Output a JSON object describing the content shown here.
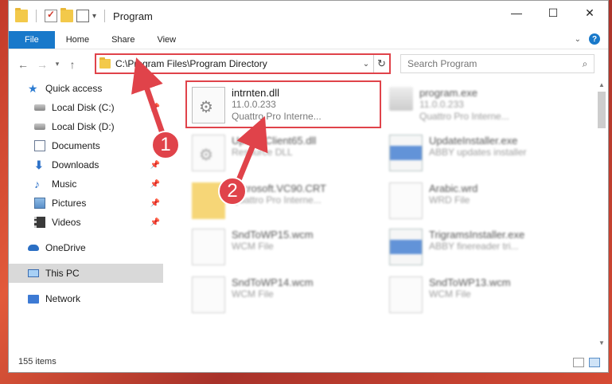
{
  "window": {
    "title": "Program"
  },
  "ribbon": {
    "tabs": [
      {
        "label": "File"
      },
      {
        "label": "Home"
      },
      {
        "label": "Share"
      },
      {
        "label": "View"
      }
    ],
    "help_label": "?"
  },
  "address": {
    "path": "C:\\Program Files\\Program Directory"
  },
  "search": {
    "placeholder": "Search Program"
  },
  "sidebar": {
    "items": [
      {
        "label": "Quick access"
      },
      {
        "label": "Local Disk (C:)"
      },
      {
        "label": "Local Disk (D:)"
      },
      {
        "label": "Documents"
      },
      {
        "label": "Downloads"
      },
      {
        "label": "Music"
      },
      {
        "label": "Pictures"
      },
      {
        "label": "Videos"
      },
      {
        "label": "OneDrive"
      },
      {
        "label": "This PC"
      },
      {
        "label": "Network"
      }
    ]
  },
  "files": [
    {
      "name": "intrnten.dll",
      "line2": "11.0.0.233",
      "line3": "Quattro Pro Interne...",
      "icon": "dll-file-icon"
    },
    {
      "name": "program.exe",
      "line2": "11.0.0.233",
      "line3": "Quattro Pro Interne...",
      "icon": "exe-icon"
    },
    {
      "name": "UpdateClient65.dll",
      "line2": "Resource DLL",
      "icon": "dll-file-icon"
    },
    {
      "name": "UpdateInstaller.exe",
      "line2": "ABBY updates installer",
      "icon": "app-icon"
    },
    {
      "name": "Microsoft.VC90.CRT",
      "line2": "Quattro Pro Interne...",
      "icon": "folder-icon"
    },
    {
      "name": "Arabic.wrd",
      "line2": "WRD File",
      "icon": "file-icon"
    },
    {
      "name": "SndToWP15.wcm",
      "line2": "WCM File",
      "icon": "file-icon"
    },
    {
      "name": "TrigramsInstaller.exe",
      "line2": "ABBY finereader tri...",
      "icon": "app-icon"
    },
    {
      "name": "SndToWP14.wcm",
      "line2": "WCM File",
      "icon": "file-icon"
    },
    {
      "name": "SndToWP13.wcm",
      "line2": "WCM File",
      "icon": "file-icon"
    }
  ],
  "status": {
    "item_count": "155 items"
  },
  "annotations": {
    "badge1": "1",
    "badge2": "2"
  },
  "colors": {
    "accent": "#1979ca",
    "highlight": "#e0434a"
  }
}
